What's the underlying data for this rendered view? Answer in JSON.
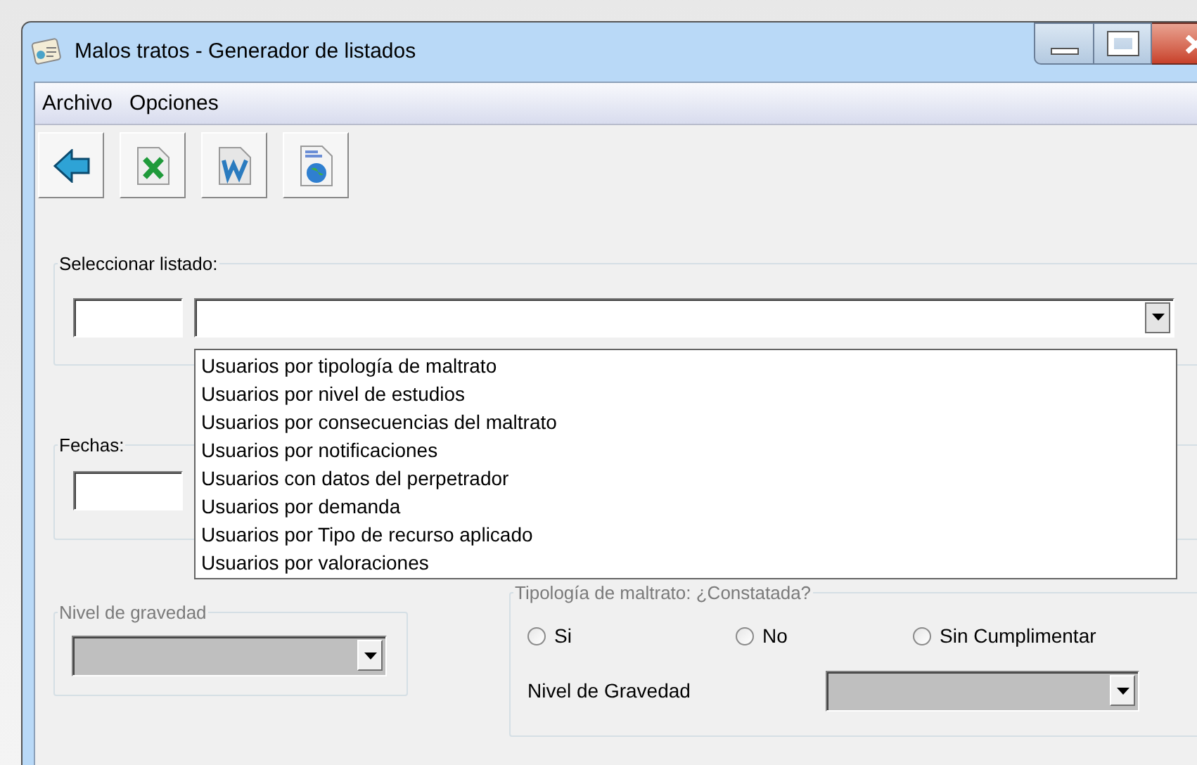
{
  "window": {
    "title": "Malos tratos - Generador de listados"
  },
  "menu": [
    "Archivo",
    "Opciones"
  ],
  "listado_group": {
    "title": "Seleccionar listado:",
    "expanded": true,
    "options": [
      "Usuarios por tipología de maltrato",
      "Usuarios por nivel de estudios",
      "Usuarios por consecuencias del maltrato",
      "Usuarios por notificaciones",
      "Usuarios con datos del perpetrador",
      "Usuarios por demanda",
      "Usuarios por Tipo de recurso aplicado",
      "Usuarios por valoraciones"
    ]
  },
  "fechas_group": {
    "title": "Fechas:"
  },
  "gravedad_group": {
    "title": "Nivel de gravedad",
    "disabled": true
  },
  "tipologia_group": {
    "title": "Tipología de maltrato: ¿Constatada?",
    "disabled": true,
    "radios": [
      {
        "label": "Si",
        "selected": false
      },
      {
        "label": "No",
        "selected": false
      },
      {
        "label": "Sin Cumplimentar",
        "selected": false
      }
    ],
    "combo_label": "Nivel de Gravedad",
    "combo_disabled": true
  }
}
